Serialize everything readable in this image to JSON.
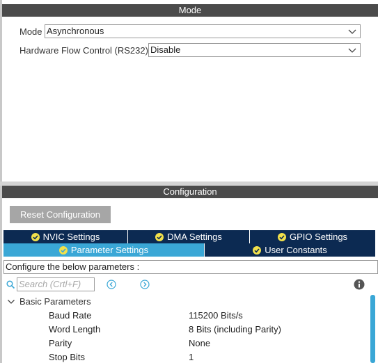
{
  "mode_section": {
    "header": "Mode",
    "mode_label": "Mode",
    "mode_value": "Asynchronous",
    "flow_label": "Hardware Flow Control (RS232)",
    "flow_value": "Disable"
  },
  "config_section": {
    "header": "Configuration",
    "reset_button": "Reset Configuration",
    "tabs": [
      {
        "label": "NVIC Settings",
        "active": false
      },
      {
        "label": "DMA Settings",
        "active": false
      },
      {
        "label": "GPIO Settings",
        "active": false
      },
      {
        "label": "Parameter Settings",
        "active": true
      },
      {
        "label": "User Constants",
        "active": false
      }
    ],
    "info_text": "Configure the below parameters :",
    "search_placeholder": "Search (Crtl+F)",
    "group_label": "Basic Parameters",
    "params": [
      {
        "name": "Baud Rate",
        "value": "115200 Bits/s"
      },
      {
        "name": "Word Length",
        "value": "8 Bits (including Parity)"
      },
      {
        "name": "Parity",
        "value": "None"
      },
      {
        "name": "Stop Bits",
        "value": "1"
      }
    ]
  },
  "colors": {
    "header_bg": "#4b4b4b",
    "tab_bg": "#0c2a52",
    "tab_active_bg": "#3aa7d6",
    "check_icon": "#f2e14b",
    "reset_button_bg": "#a6a6a6",
    "nav_icon": "#3aa7d6"
  },
  "icons": [
    "chevron-down-icon",
    "check-circle-icon",
    "search-icon",
    "arrow-left-circle-icon",
    "arrow-right-circle-icon",
    "info-icon",
    "chevron-down-icon"
  ]
}
